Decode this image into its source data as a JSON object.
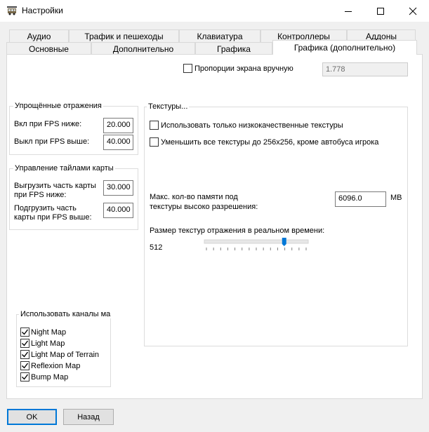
{
  "window": {
    "title": "Настройки"
  },
  "tabs_row1": [
    {
      "label": "Аудио"
    },
    {
      "label": "Трафик и пешеходы"
    },
    {
      "label": "Клавиатура"
    },
    {
      "label": "Контроллеры"
    },
    {
      "label": "Аддоны"
    }
  ],
  "tabs_row2": [
    {
      "label": "Основные"
    },
    {
      "label": "Дополнительно"
    },
    {
      "label": "Графика"
    },
    {
      "label": "Графика (дополнительно)"
    }
  ],
  "aspect": {
    "label": "Пропорции экрана вручную",
    "value": "1.778",
    "checked": false
  },
  "reflections": {
    "title": "Упрощённые отражения",
    "on_label": "Вкл при FPS ниже:",
    "on_value": "20.000",
    "off_label": "Выкл при FPS выше:",
    "off_value": "40.000"
  },
  "tiles": {
    "title": "Управление тайлами карты",
    "unload_label_1": "Выгрузить часть карты",
    "unload_label_2": "при FPS ниже:",
    "unload_value": "30.000",
    "load_label_1": "Подгрузить часть",
    "load_label_2": "карты при FPS выше:",
    "load_value": "40.000"
  },
  "channels": {
    "title": "Использовать каналы ма",
    "items": [
      {
        "label": "Night Map",
        "checked": true
      },
      {
        "label": "Light Map",
        "checked": true
      },
      {
        "label": "Light Map of Terrain",
        "checked": true
      },
      {
        "label": "Reflexion Map",
        "checked": true
      },
      {
        "label": "Bump Map",
        "checked": true
      }
    ]
  },
  "textures": {
    "title": "Текстуры...",
    "low_quality_label": "Использовать только низкокачественные текстуры",
    "low_quality_checked": false,
    "reduce_label": "Уменьшить все текстуры до 256x256, кроме автобуса игрока",
    "reduce_checked": false,
    "max_mem_label_1": "Макс. кол-во памяти под",
    "max_mem_label_2": "текстуры высоко разрешения:",
    "max_mem_value": "6096.0",
    "max_mem_unit": "MB",
    "reflection_size_label": "Размер текстур отражения в реальном времени:",
    "reflection_size_value": "512",
    "slider_fraction": 0.78
  },
  "buttons": {
    "ok": "OK",
    "back": "Назад"
  }
}
